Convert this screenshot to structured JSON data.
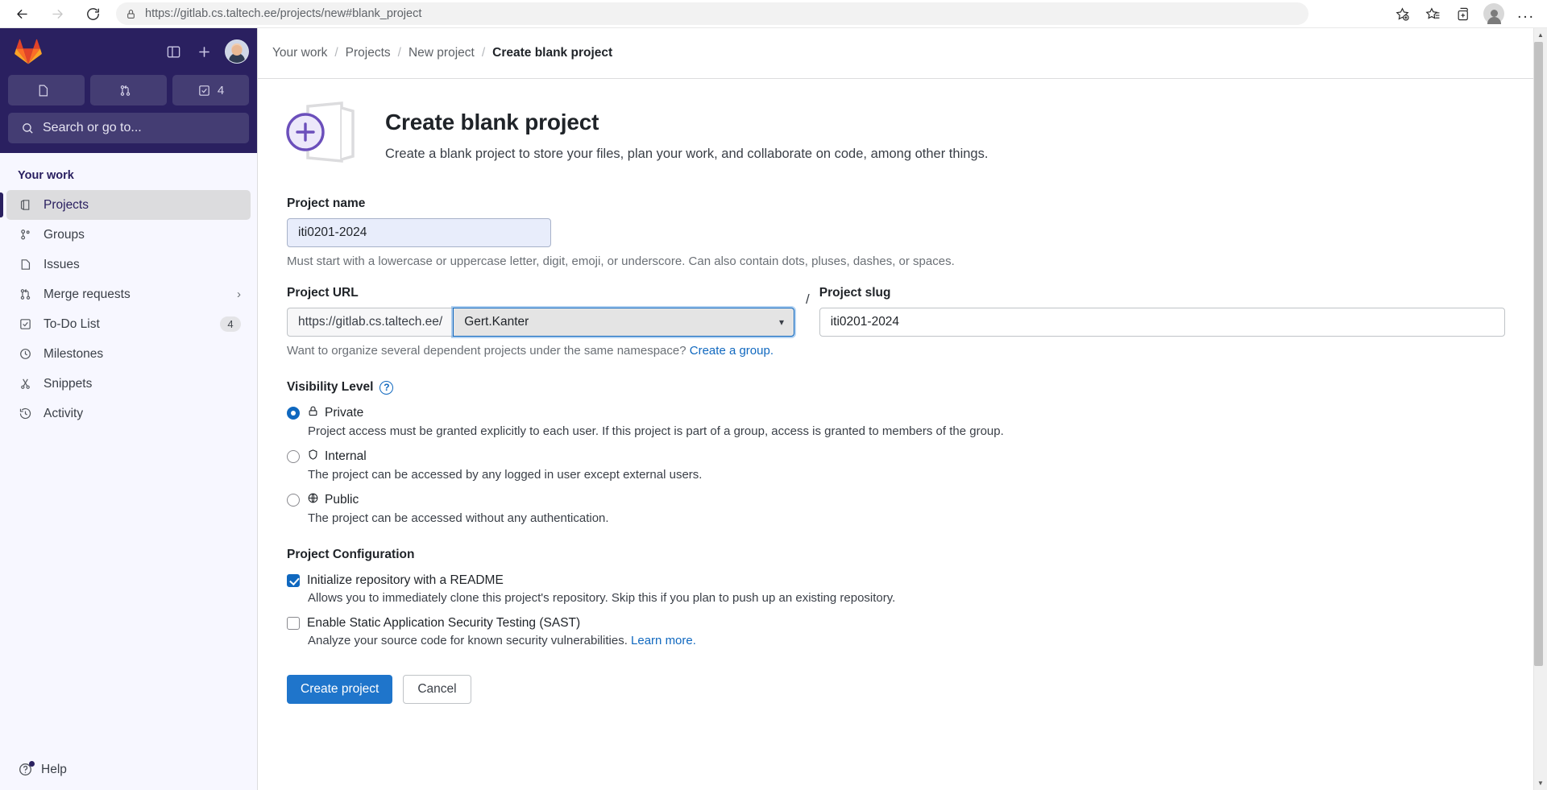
{
  "browser": {
    "back_icon": "arrow-left-icon",
    "forward_icon": "arrow-right-icon",
    "reload_icon": "reload-icon",
    "lock_icon": "lock-icon",
    "url_prefix": "https://",
    "url_host": "gitlab.cs.taltech.ee",
    "url_path": "/projects/new#blank_project",
    "url_full": "https://gitlab.cs.taltech.ee/projects/new#blank_project",
    "actions": [
      {
        "name": "add-favorite-icon",
        "glyph": "star-plus"
      },
      {
        "name": "favorites-icon",
        "glyph": "star-list"
      },
      {
        "name": "collections-icon",
        "glyph": "collections"
      },
      {
        "name": "browser-profile-avatar",
        "glyph": "avatar"
      },
      {
        "name": "settings-more-icon",
        "glyph": "..."
      }
    ]
  },
  "sidebar": {
    "logo": "gitlab-logo-icon",
    "toggle_icon": "sidebar-toggle-icon",
    "create_new_icon": "plus-icon",
    "user_avatar": "user-avatar",
    "quick_buttons": [
      {
        "name": "issues",
        "icon": "issues-icon",
        "count": ""
      },
      {
        "name": "merge-requests",
        "icon": "merge-request-icon",
        "count": ""
      },
      {
        "name": "todos",
        "icon": "todo-check-icon",
        "count": "4"
      }
    ],
    "search_placeholder": "Search or go to...",
    "search_icon": "search-icon",
    "section_title": "Your work",
    "items": [
      {
        "label": "Projects",
        "icon": "projects-icon",
        "active": true,
        "badge": "",
        "chevron": false
      },
      {
        "label": "Groups",
        "icon": "groups-icon",
        "active": false,
        "badge": "",
        "chevron": false
      },
      {
        "label": "Issues",
        "icon": "issues-icon",
        "active": false,
        "badge": "",
        "chevron": false
      },
      {
        "label": "Merge requests",
        "icon": "merge-request-icon",
        "active": false,
        "badge": "",
        "chevron": true
      },
      {
        "label": "To-Do List",
        "icon": "todo-check-icon",
        "active": false,
        "badge": "4",
        "chevron": false
      },
      {
        "label": "Milestones",
        "icon": "clock-icon",
        "active": false,
        "badge": "",
        "chevron": false
      },
      {
        "label": "Snippets",
        "icon": "scissors-icon",
        "active": false,
        "badge": "",
        "chevron": false
      },
      {
        "label": "Activity",
        "icon": "history-icon",
        "active": false,
        "badge": "",
        "chevron": false
      }
    ],
    "help_label": "Help",
    "help_icon": "question-circle-icon"
  },
  "breadcrumb": {
    "items": [
      "Your work",
      "Projects",
      "New project"
    ],
    "current": "Create blank project",
    "separator": "/"
  },
  "hero": {
    "illustration": "blank-project-plus-icon",
    "title": "Create blank project",
    "subtitle": "Create a blank project to store your files, plan your work, and collaborate on code, among other things."
  },
  "form": {
    "project_name": {
      "label": "Project name",
      "value": "iti0201-2024",
      "placeholder": "",
      "hint": "Must start with a lowercase or uppercase letter, digit, emoji, or underscore. Can also contain dots, pluses, dashes, or spaces."
    },
    "project_url": {
      "label": "Project URL",
      "prefix": "https://gitlab.cs.taltech.ee/",
      "namespace_value": "Gert.Kanter",
      "caret_icon": "chevron-down-icon",
      "separator": "/",
      "hint_text": "Want to organize several dependent projects under the same namespace?",
      "hint_link": "Create a group."
    },
    "project_slug": {
      "label": "Project slug",
      "value": "iti0201-2024"
    },
    "visibility": {
      "label": "Visibility Level",
      "help_icon": "question-circle-icon",
      "options": [
        {
          "label": "Private",
          "icon": "lock-icon",
          "checked": true,
          "description": "Project access must be granted explicitly to each user. If this project is part of a group, access is granted to members of the group."
        },
        {
          "label": "Internal",
          "icon": "shield-icon",
          "checked": false,
          "description": "The project can be accessed by any logged in user except external users."
        },
        {
          "label": "Public",
          "icon": "globe-icon",
          "checked": false,
          "description": "The project can be accessed without any authentication."
        }
      ]
    },
    "configuration": {
      "label": "Project Configuration",
      "options": [
        {
          "label": "Initialize repository with a README",
          "checked": true,
          "description": "Allows you to immediately clone this project's repository. Skip this if you plan to push up an existing repository.",
          "link": ""
        },
        {
          "label": "Enable Static Application Security Testing (SAST)",
          "checked": false,
          "description": "Analyze your source code for known security vulnerabilities.",
          "link": "Learn more."
        }
      ]
    },
    "submit_label": "Create project",
    "cancel_label": "Cancel"
  },
  "colors": {
    "sidebar_bg": "#2a2060",
    "accent_blue": "#1f75cb",
    "link_blue": "#1068bf",
    "gitlab_orange": "#fc6d26",
    "gitlab_purple": "#6b4fbb"
  },
  "scrollbar": {
    "up_icon": "caret-up-icon",
    "down_icon": "caret-down-icon"
  }
}
